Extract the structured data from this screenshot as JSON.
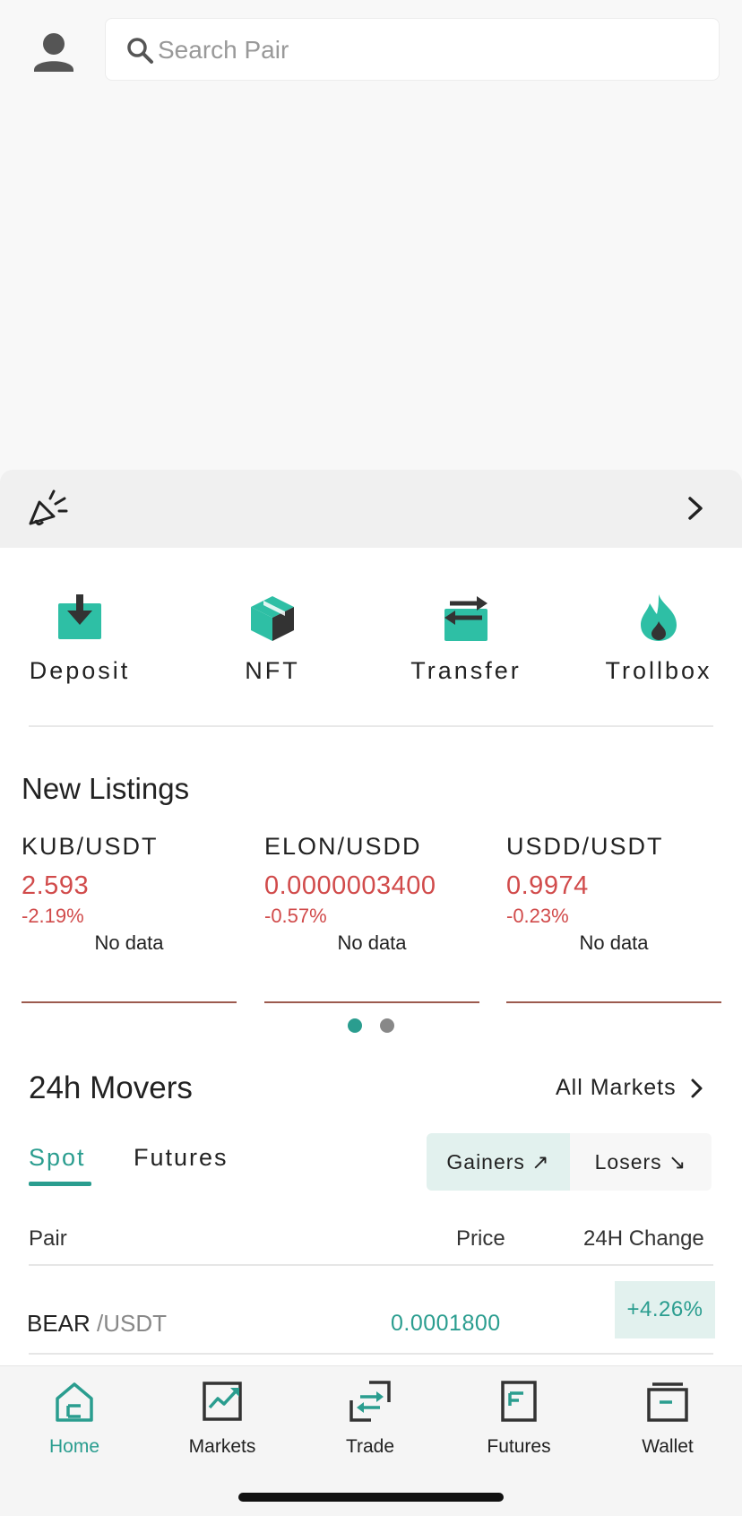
{
  "search": {
    "placeholder": "Search Pair"
  },
  "quick_actions": [
    {
      "label": "Deposit",
      "icon": "download-box-icon"
    },
    {
      "label": "NFT",
      "icon": "cube-icon"
    },
    {
      "label": "Transfer",
      "icon": "transfer-arrows-icon"
    },
    {
      "label": "Trollbox",
      "icon": "flame-icon"
    }
  ],
  "new_listings": {
    "title": "New Listings",
    "items": [
      {
        "pair": "KUB/USDT",
        "price": "2.593",
        "change": "-2.19%",
        "chart_status": "No data"
      },
      {
        "pair": "ELON/USDD",
        "price": "0.0000003400",
        "change": "-0.57%",
        "chart_status": "No data"
      },
      {
        "pair": "USDD/USDT",
        "price": "0.9974",
        "change": "-0.23%",
        "chart_status": "No data"
      }
    ],
    "page_indicator": {
      "total": 2,
      "active": 1
    }
  },
  "movers": {
    "title": "24h Movers",
    "all_markets_label": "All Markets",
    "tabs": [
      "Spot",
      "Futures"
    ],
    "active_tab": "Spot",
    "toggle": {
      "gainers": "Gainers ↗",
      "losers": "Losers ↘",
      "active": "gainers"
    },
    "columns": {
      "pair": "Pair",
      "price": "Price",
      "change": "24H Change"
    },
    "rows": [
      {
        "base": "BEAR",
        "quote": "/USDT",
        "price": "0.0001800",
        "change": "+4.26%"
      }
    ]
  },
  "nav": {
    "items": [
      {
        "label": "Home",
        "icon": "home-icon",
        "active": true
      },
      {
        "label": "Markets",
        "icon": "markets-chart-icon",
        "active": false
      },
      {
        "label": "Trade",
        "icon": "trade-arrows-icon",
        "active": false
      },
      {
        "label": "Futures",
        "icon": "futures-doc-icon",
        "active": false
      },
      {
        "label": "Wallet",
        "icon": "wallet-icon",
        "active": false
      }
    ]
  },
  "colors": {
    "accent": "#2a9d8f",
    "negative": "#d14b4b",
    "dark_icon": "#333333"
  }
}
